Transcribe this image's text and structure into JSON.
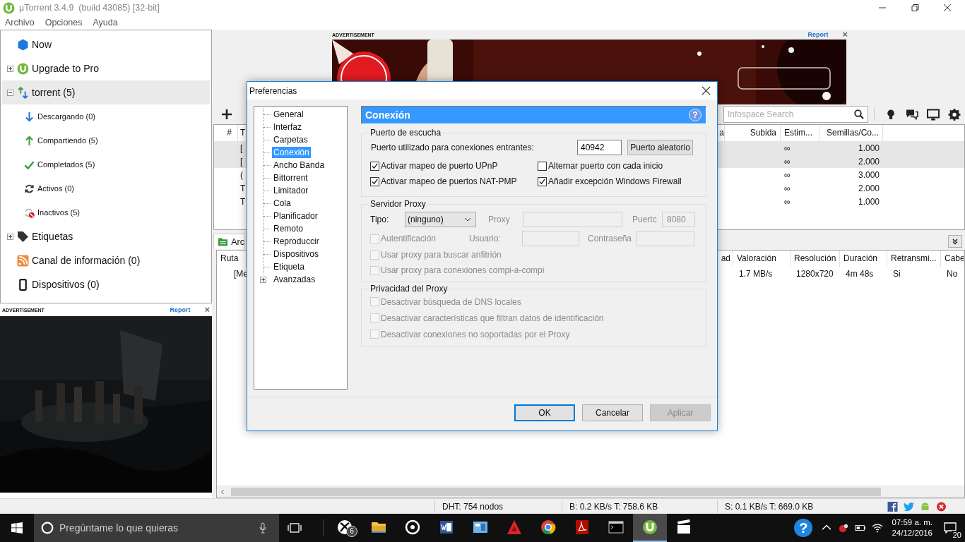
{
  "window": {
    "title": "µTorrent 3.4.9  (build 43085) [32-bit]"
  },
  "menu": [
    "Archivo",
    "Opciones",
    "Ayuda"
  ],
  "sidebar": {
    "items": [
      {
        "label": "Now",
        "kind": "now",
        "selected": false
      },
      {
        "label": "Upgrade to Pro",
        "kind": "upgrade",
        "selected": false,
        "expanded": false
      },
      {
        "label": "torrent (5)",
        "kind": "torrent",
        "selected": true,
        "expanded": true,
        "children": [
          {
            "label": "Descargando (0)",
            "kind": "downloading",
            "selected": false
          },
          {
            "label": "Compartiendo (5)",
            "kind": "seeding",
            "selected": false
          },
          {
            "label": "Completados (5)",
            "kind": "completed",
            "selected": false
          },
          {
            "label": "Activos (0)",
            "kind": "active",
            "selected": false
          },
          {
            "label": "Inactivos (5)",
            "kind": "inactive",
            "selected": false
          }
        ]
      },
      {
        "label": "Etiquetas",
        "kind": "labels",
        "selected": false,
        "expanded": false
      },
      {
        "label": "Canal de información (0)",
        "kind": "feed",
        "selected": false
      },
      {
        "label": "Dispositivos (0)",
        "kind": "devices",
        "selected": false
      }
    ]
  },
  "side_ad": {
    "label": "ADVERTISEMENT",
    "report": "Report",
    "close": "×",
    "kind": "picture"
  },
  "top_ad": {
    "label": "ADVERTISEMENT",
    "report": "Report",
    "close": "×",
    "kind": "picture"
  },
  "search": {
    "placeholder": "Infospace Search"
  },
  "torrents": {
    "columns": [
      "#",
      "T",
      "a",
      "Subida",
      "Estim...",
      "Semillas/Co..."
    ],
    "rows": [
      {
        "selected": true,
        "column_2": "[",
        "eta": "∞",
        "seeds": "1.000"
      },
      {
        "selected": true,
        "column_2": "[",
        "eta": "∞",
        "seeds": "2.000"
      },
      {
        "selected": false,
        "column_2": "(",
        "eta": "∞",
        "seeds": "3.000"
      },
      {
        "selected": false,
        "column_2": "T",
        "eta": "∞",
        "seeds": "2.000"
      },
      {
        "selected": false,
        "column_2": "T",
        "eta": "∞",
        "seeds": "1.000"
      }
    ]
  },
  "files": {
    "tab": "Arc",
    "columns": [
      "Ruta",
      "ad",
      "Valoración",
      "Resolución",
      "Duración",
      "Retransmi...",
      "Cabe"
    ],
    "rows": [
      {
        "path": "[Me",
        "rating": "1.7 MB/s",
        "resolution": "1280x720",
        "duration": "4m 48s",
        "streamable": "Si",
        "header": "No"
      }
    ]
  },
  "dialog": {
    "title": "Preferencias",
    "nav": [
      {
        "label": "General",
        "selected": false
      },
      {
        "label": "Interfaz",
        "selected": false
      },
      {
        "label": "Carpetas",
        "selected": false
      },
      {
        "label": "Conexión",
        "selected": true
      },
      {
        "label": "Ancho Banda",
        "selected": false
      },
      {
        "label": "Bittorrent",
        "selected": false
      },
      {
        "label": "Limitador",
        "selected": false
      },
      {
        "label": "Cola",
        "selected": false
      },
      {
        "label": "Planificador",
        "selected": false
      },
      {
        "label": "Remoto",
        "selected": false
      },
      {
        "label": "Reproduccir",
        "selected": false
      },
      {
        "label": "Dispositivos",
        "selected": false
      },
      {
        "label": "Etiqueta",
        "selected": false
      },
      {
        "label": "Avanzadas",
        "selected": false,
        "expanded": false
      }
    ],
    "section_title": "Conexión",
    "help": "?",
    "listening": {
      "title": "Puerto de escucha",
      "port_label": "Puerto utilizado para conexiones entrantes:",
      "port": "40942",
      "random_button": "Puerto aleatorio",
      "options": [
        {
          "label": "Activar mapeo de puerto UPnP",
          "checked": true
        },
        {
          "label": "Alternar puerto con cada inicio",
          "checked": false
        },
        {
          "label": "Activar mapeo de puertos NAT-PMP",
          "checked": true
        },
        {
          "label": "Añadir excepción Windows Firewall",
          "checked": true
        }
      ]
    },
    "proxy": {
      "title": "Servidor Proxy",
      "type_label": "Tipo:",
      "type_value": "(ninguno)",
      "proxy_label": "Proxy",
      "port_label": "Puertc",
      "port": "8080",
      "auth": {
        "label": "Autentificación",
        "checked": false,
        "disabled": true
      },
      "user_label": "Usuario:",
      "password_label": "Contraseña",
      "options": [
        {
          "label": "Usar proxy para buscar anfitrión",
          "checked": false,
          "disabled": true
        },
        {
          "label": "Usar proxy para conexiones compi-a-compi",
          "checked": false,
          "disabled": true
        }
      ]
    },
    "privacy": {
      "title": "Privacidad del Proxy",
      "options": [
        {
          "label": "Desactivar búsqueda de DNS locales",
          "checked": false,
          "disabled": true
        },
        {
          "label": "Desactivar características que filtran datos de identificación",
          "checked": false,
          "disabled": true
        },
        {
          "label": "Desactivar conexiones no soportadas por el Proxy",
          "checked": false,
          "disabled": true
        }
      ]
    },
    "buttons": [
      {
        "label": "OK",
        "kind": "default",
        "disabled": false
      },
      {
        "label": "Cancelar",
        "kind": "normal",
        "disabled": false
      },
      {
        "label": "Aplicar",
        "kind": "normal",
        "disabled": true
      }
    ]
  },
  "status_bar": {
    "dht": "DHT: 754 nodos",
    "download": "B: 0.2 KB/s T: 758.6 KB",
    "upload": "S: 0.1 KB/s T: 669.0 KB"
  },
  "taskbar": {
    "search_placeholder": "Pregúntame lo que quieras",
    "xbox_badge": "6",
    "apps": [
      {
        "kind": "xbox",
        "selected": false
      },
      {
        "kind": "folder",
        "selected": false
      },
      {
        "kind": "groove",
        "selected": false
      },
      {
        "kind": "word",
        "selected": false
      },
      {
        "kind": "calc",
        "selected": false
      },
      {
        "kind": "autocad",
        "selected": false
      },
      {
        "kind": "chrome",
        "selected": false
      },
      {
        "kind": "pdf",
        "selected": false
      },
      {
        "kind": "console",
        "selected": false
      },
      {
        "kind": "utorrent",
        "selected": true
      },
      {
        "kind": "film",
        "selected": false
      }
    ],
    "help": "?",
    "time": "07:59 a. m.",
    "date": "24/12/2016",
    "notifications": "20"
  }
}
